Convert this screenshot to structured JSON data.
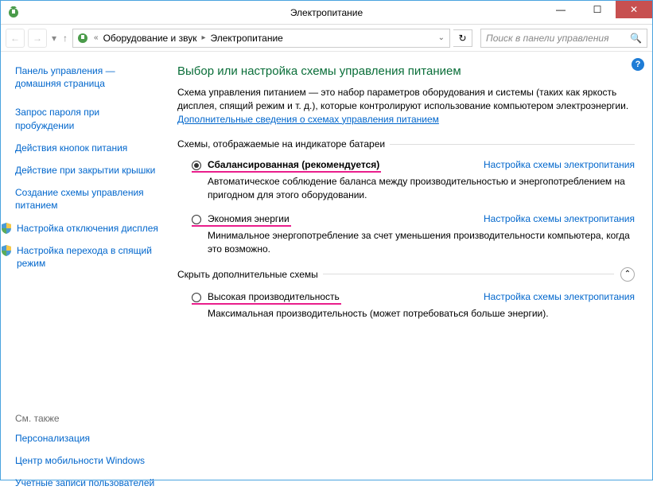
{
  "window": {
    "title": "Электропитание"
  },
  "nav": {
    "breadcrumb": {
      "item1": "Оборудование и звук",
      "item2": "Электропитание"
    },
    "search_placeholder": "Поиск в панели управления"
  },
  "sidebar": {
    "home": "Панель управления — домашняя страница",
    "links": {
      "l0": "Запрос пароля при пробуждении",
      "l1": "Действия кнопок питания",
      "l2": "Действие при закрытии крышки",
      "l3": "Создание схемы управления питанием",
      "l4": "Настройка отключения дисплея",
      "l5": "Настройка перехода в спящий режим"
    },
    "see_also_label": "См. также",
    "see_also": {
      "s0": "Персонализация",
      "s1": "Центр мобильности Windows",
      "s2": "Учетные записи пользователей"
    }
  },
  "main": {
    "title": "Выбор или настройка схемы управления питанием",
    "desc_pre": "Схема управления питанием — это набор параметров оборудования и системы (таких как яркость дисплея, спящий режим и т. д.), которые контролируют использование компьютером электроэнергии. ",
    "desc_link": "Дополнительные сведения о схемах управления питанием",
    "section1_label": "Схемы, отображаемые на индикаторе батареи",
    "section2_label": "Скрыть дополнительные схемы",
    "change_link": "Настройка схемы электропитания",
    "plans": {
      "p0": {
        "name": "Сбалансированная (рекомендуется)",
        "desc": "Автоматическое соблюдение баланса между производительностью и энергопотреблением на пригодном для этого оборудовании."
      },
      "p1": {
        "name": "Экономия энергии",
        "desc": "Минимальное энергопотребление за счет уменьшения производительности компьютера, когда это возможно."
      },
      "p2": {
        "name": "Высокая производительность",
        "desc": "Максимальная производительность (может потребоваться больше энергии)."
      }
    }
  }
}
